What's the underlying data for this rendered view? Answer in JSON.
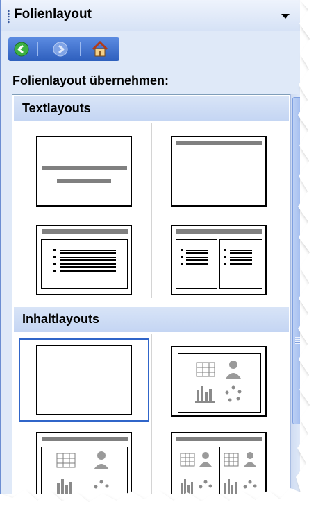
{
  "task_pane": {
    "title": "Folienlayout",
    "dropdown_icon": "triangle-down-icon",
    "nav": {
      "back_icon": "back-arrow-icon",
      "forward_icon": "forward-arrow-icon",
      "home_icon": "home-icon"
    },
    "heading": "Folienlayout übernehmen:",
    "sections": [
      {
        "label": "Textlayouts"
      },
      {
        "label": "Inhaltlayouts"
      }
    ],
    "colors": {
      "panel_bg": "#dfe9f8",
      "section_header_bg": "#c9d8f4",
      "nav_bar": "#3a6fd1",
      "selection": "#3065c9",
      "placeholder_gray": "#808080"
    }
  }
}
